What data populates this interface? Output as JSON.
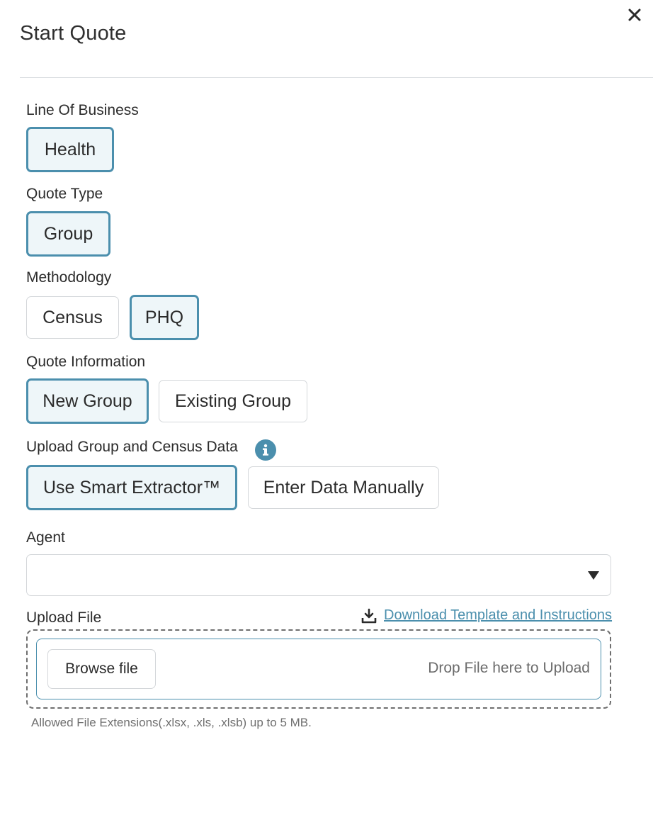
{
  "dialog": {
    "title": "Start Quote",
    "close_icon": "close-icon"
  },
  "line_of_business": {
    "label": "Line Of Business",
    "options": [
      {
        "label": "Health",
        "selected": true
      }
    ]
  },
  "quote_type": {
    "label": "Quote Type",
    "options": [
      {
        "label": "Group",
        "selected": true
      }
    ]
  },
  "methodology": {
    "label": "Methodology",
    "options": [
      {
        "label": "Census",
        "selected": false
      },
      {
        "label": "PHQ",
        "selected": true
      }
    ]
  },
  "quote_information": {
    "label": "Quote Information",
    "options": [
      {
        "label": "New Group",
        "selected": true
      },
      {
        "label": "Existing Group",
        "selected": false
      }
    ]
  },
  "upload_group": {
    "label": "Upload Group and Census Data",
    "info_icon": "info-icon",
    "options": [
      {
        "label": "Use Smart Extractor™",
        "selected": true
      },
      {
        "label": "Enter Data Manually",
        "selected": false
      }
    ]
  },
  "agent": {
    "label": "Agent",
    "value": "",
    "caret_icon": "caret-down-icon"
  },
  "upload_file": {
    "label": "Upload File",
    "download_link": "Download Template and Instructions",
    "download_icon": "download-icon",
    "browse_button": "Browse file",
    "drop_text": "Drop File here to Upload",
    "hint": "Allowed File Extensions(.xlsx, .xls, .xlsb) up to 5 MB."
  },
  "colors": {
    "accent": "#4b8fad",
    "selected_bg": "#eef6f9",
    "border": "#d4d7da"
  }
}
